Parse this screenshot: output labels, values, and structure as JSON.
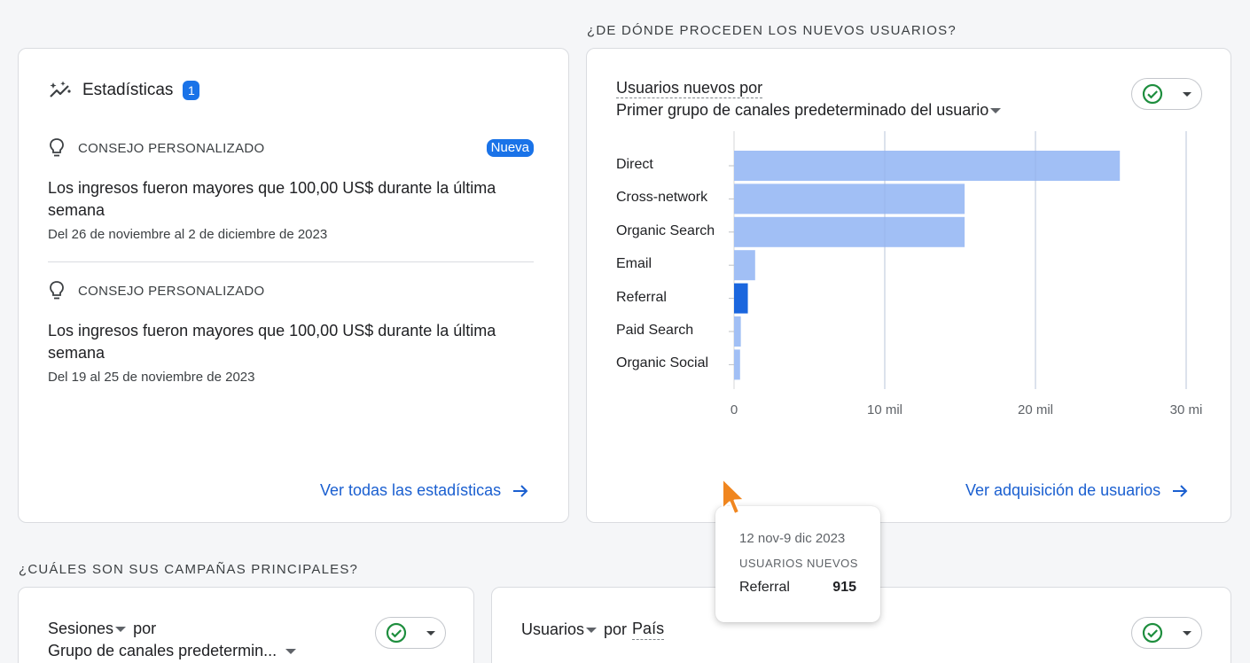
{
  "sections": {
    "new_users_title": "¿DE DÓNDE PROCEDEN LOS NUEVOS USUARIOS?",
    "campaigns_title": "¿CUÁLES SON SUS CAMPAÑAS PRINCIPALES?"
  },
  "insights": {
    "title": "Estadísticas",
    "count": "1",
    "tips": [
      {
        "kicker": "CONSEJO PERSONALIZADO",
        "badge": "Nueva",
        "text": "Los ingresos fueron mayores que 100,00 US$ durante la última semana",
        "date": "Del 26 de noviembre al 2 de diciembre de 2023"
      },
      {
        "kicker": "CONSEJO PERSONALIZADO",
        "text": "Los ingresos fueron mayores que 100,00 US$ durante la última semana",
        "date": "Del 19 al 25 de noviembre de 2023"
      }
    ],
    "link": "Ver todas las estadísticas"
  },
  "new_users_card": {
    "metric": "Usuarios nuevos por",
    "dimension": "Primer grupo de canales predeterminado del usuario",
    "link": "Ver adquisición de usuarios"
  },
  "chart_data": {
    "type": "bar",
    "orientation": "horizontal",
    "categories": [
      "Direct",
      "Cross-network",
      "Organic Search",
      "Email",
      "Referral",
      "Paid Search",
      "Organic Social"
    ],
    "values": [
      25600,
      15300,
      15300,
      1400,
      915,
      450,
      400
    ],
    "xlim": [
      0,
      30000
    ],
    "ticks": [
      "0",
      "10 mil",
      "20 mil",
      "30 mi"
    ],
    "highlighted": "Referral",
    "colors": {
      "bar": "#a1bff5",
      "highlight": "#1a66de",
      "grid": "#d5d7da"
    }
  },
  "tooltip": {
    "date": "12 nov-9 dic 2023",
    "metric": "USUARIOS NUEVOS",
    "label": "Referral",
    "value": "915"
  },
  "campaign_card_1": {
    "metric": "Sesiones",
    "by": "por",
    "dimension": "Grupo de canales predetermin..."
  },
  "campaign_card_2": {
    "metric": "Usuarios",
    "by": "por",
    "dimension": "País"
  },
  "icons": {
    "insights": "insights-sparkle-icon",
    "tip": "lightbulb-icon",
    "arrow": "arrow-right-icon",
    "check": "check-circle-icon",
    "cursor": "mouse-pointer-icon"
  },
  "colors": {
    "accent": "#1a73e8",
    "check": "#1e8e3e",
    "cursor": "#f0861f"
  }
}
